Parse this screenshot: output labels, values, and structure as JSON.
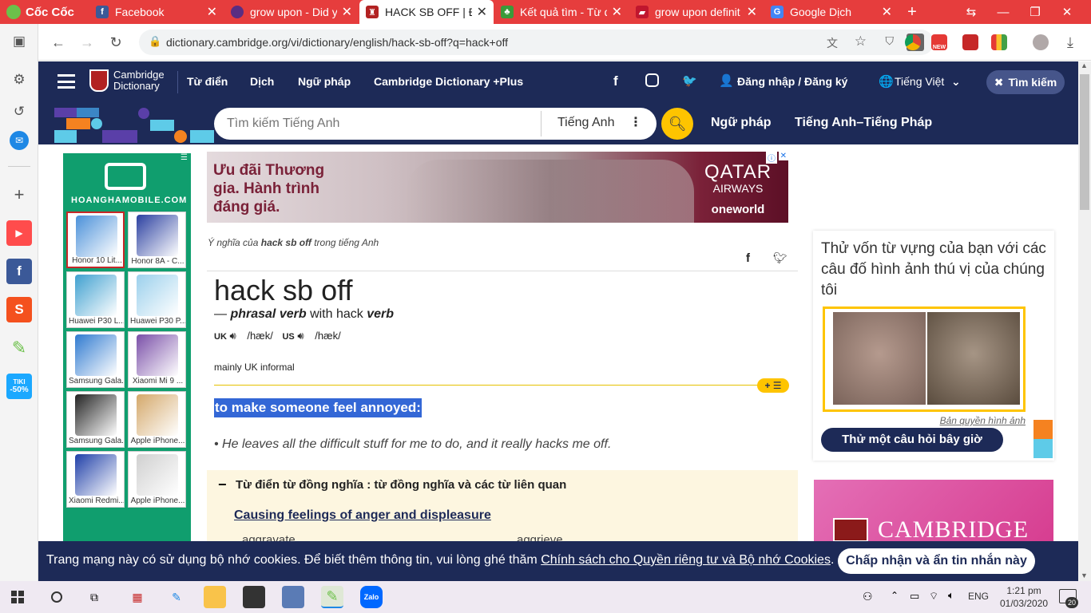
{
  "browser": {
    "brand": "Cốc Cốc",
    "tabs": [
      {
        "label": "Facebook"
      },
      {
        "label": "grow upon - Did y"
      },
      {
        "label": "HACK SB OFF | Địn"
      },
      {
        "label": "Kết quả tìm - Từ đ"
      },
      {
        "label": "grow upon definit"
      },
      {
        "label": "Google Dịch"
      }
    ],
    "url": "dictionary.cambridge.org/vi/dictionary/english/hack-sb-off?q=hack+off"
  },
  "sidebar_badges": {
    "tiki": "TIKI",
    "tiki_discount": "-50%"
  },
  "header": {
    "logo_line1": "Cambridge",
    "logo_line2": "Dictionary",
    "nav": [
      "Từ điển",
      "Dịch",
      "Ngữ pháp",
      "Cambridge Dictionary +Plus"
    ],
    "login": "Đăng nhập / Đăng ký",
    "language": "Tiếng Việt",
    "search_close": "Tìm kiếm"
  },
  "search": {
    "placeholder": "Tìm kiếm Tiếng Anh",
    "dict": "Tiếng Anh",
    "links": [
      "Ngữ pháp",
      "Tiếng Anh–Tiếng Pháp"
    ]
  },
  "left_ad": {
    "brand": "HOANGHAMOBILE.COM",
    "phones": [
      {
        "label": "Honor 10 Lit..."
      },
      {
        "label": "Honor 8A - C..."
      },
      {
        "label": "Huawei P30 L..."
      },
      {
        "label": "Huawei P30 P..."
      },
      {
        "label": "Samsung Gala..."
      },
      {
        "label": "Xiaomi Mi 9 ..."
      },
      {
        "label": "Samsung Gala..."
      },
      {
        "label": "Apple iPhone..."
      },
      {
        "label": "Xiaomi Redmi..."
      },
      {
        "label": "Apple iPhone..."
      }
    ]
  },
  "top_ad": {
    "line1": "Ưu đãi Thương",
    "line2": "gia. Hành trình",
    "line3": "đáng giá.",
    "brand": "QATAR",
    "brand2": "AIRWAYS",
    "alliance": "oneworld"
  },
  "entry": {
    "meaning_prefix": "Ý nghĩa của",
    "meaning_word": "hack sb off",
    "meaning_suffix": "trong tiếng Anh",
    "headword": "hack sb off",
    "pos_dash": "—",
    "pos": "phrasal verb",
    "pos_with": "with hack",
    "pos_verb": "verb",
    "uk": "UK",
    "uk_ipa": "/hæk/",
    "us": "US",
    "us_ipa": "/hæk/",
    "register": "mainly UK informal",
    "definition": "to make someone feel annoyed:",
    "example": "He leaves all the difficult stuff for me to do, and it really hacks me off.",
    "thesaurus_title": "Từ điển từ đồng nghĩa : từ đồng nghĩa và các từ liên quan",
    "thesaurus_topic": "Causing feelings of anger and displeasure",
    "thesaurus_words": [
      "aggravate",
      "aggrieve"
    ]
  },
  "quiz": {
    "title": "Thử vốn từ vựng của bạn với các câu đố hình ảnh thú vị của chúng tôi",
    "credit": "Bản quyền hình ảnh",
    "button": "Thử một câu hỏi bây giờ"
  },
  "right_ad": {
    "brand": "CAMBRIDGE"
  },
  "cookie": {
    "text": "Trang mạng này có sử dụng bộ nhớ cookies. Để biết thêm thông tin, vui lòng ghé thăm",
    "link": "Chính sách cho Quyền riêng tư và Bộ nhớ Cookies",
    "button": "Chấp nhận và ẩn tin nhắn này"
  },
  "taskbar": {
    "lang": "ENG",
    "time": "1:21 pm",
    "date": "01/03/2020",
    "notif": "20",
    "zalo": "Zalo"
  },
  "colors": {
    "navy": "#1d2a57",
    "yellow": "#fec400",
    "chrome_red": "#e63d3d"
  }
}
